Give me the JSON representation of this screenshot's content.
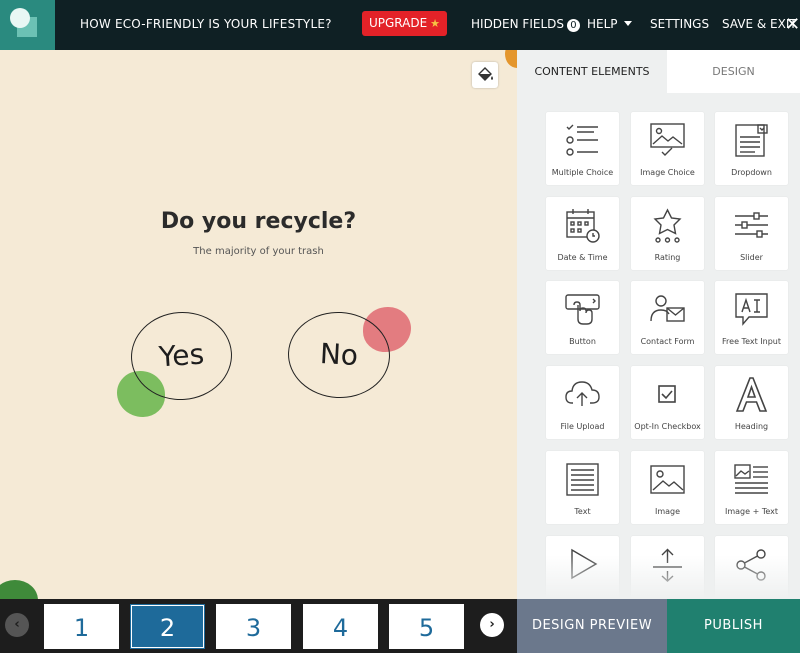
{
  "header": {
    "title": "HOW ECO-FRIENDLY IS YOUR LIFESTYLE?",
    "upgrade_label": "UPGRADE",
    "hidden_fields_label": "HIDDEN FIELDS",
    "hidden_fields_count": "0",
    "help_label": "HELP",
    "settings_label": "SETTINGS",
    "save_exit_label": "SAVE & EXIT",
    "close_glyph": "✕"
  },
  "canvas": {
    "question": "Do you recycle?",
    "subtitle": "The majority of your trash",
    "answers": [
      "Yes",
      "No"
    ]
  },
  "panel": {
    "tabs": [
      "CONTENT ELEMENTS",
      "DESIGN"
    ],
    "active_tab": "CONTENT ELEMENTS",
    "elements": [
      {
        "label": "Multiple Choice",
        "icon": "multiple-choice-icon"
      },
      {
        "label": "Image Choice",
        "icon": "image-choice-icon"
      },
      {
        "label": "Dropdown",
        "icon": "dropdown-icon"
      },
      {
        "label": "Date & Time",
        "icon": "calendar-icon"
      },
      {
        "label": "Rating",
        "icon": "star-rating-icon"
      },
      {
        "label": "Slider",
        "icon": "slider-icon"
      },
      {
        "label": "Button",
        "icon": "button-click-icon"
      },
      {
        "label": "Contact Form",
        "icon": "contact-form-icon"
      },
      {
        "label": "Free Text Input",
        "icon": "free-text-icon"
      },
      {
        "label": "File Upload",
        "icon": "cloud-upload-icon"
      },
      {
        "label": "Opt-In Checkbox",
        "icon": "checkbox-icon"
      },
      {
        "label": "Heading",
        "icon": "heading-icon"
      },
      {
        "label": "Text",
        "icon": "text-icon"
      },
      {
        "label": "Image",
        "icon": "image-icon"
      },
      {
        "label": "Image + Text",
        "icon": "image-text-icon"
      },
      {
        "label": "",
        "icon": "video-play-icon"
      },
      {
        "label": "",
        "icon": "spacer-icon"
      },
      {
        "label": "",
        "icon": "share-icon"
      }
    ]
  },
  "footer": {
    "pages": [
      "1",
      "2",
      "3",
      "4",
      "5"
    ],
    "active_page": "2",
    "design_preview_label": "DESIGN PREVIEW",
    "publish_label": "PUBLISH"
  },
  "colors": {
    "topbar": "#0f2024",
    "upgrade": "#e32228",
    "canvas_bg": "#f5ead6",
    "page_accent": "#1e6a9a",
    "publish": "#20806f",
    "design_preview": "#6b788c",
    "blob_green": "#7cbd5f",
    "blob_red": "#e2767b"
  }
}
